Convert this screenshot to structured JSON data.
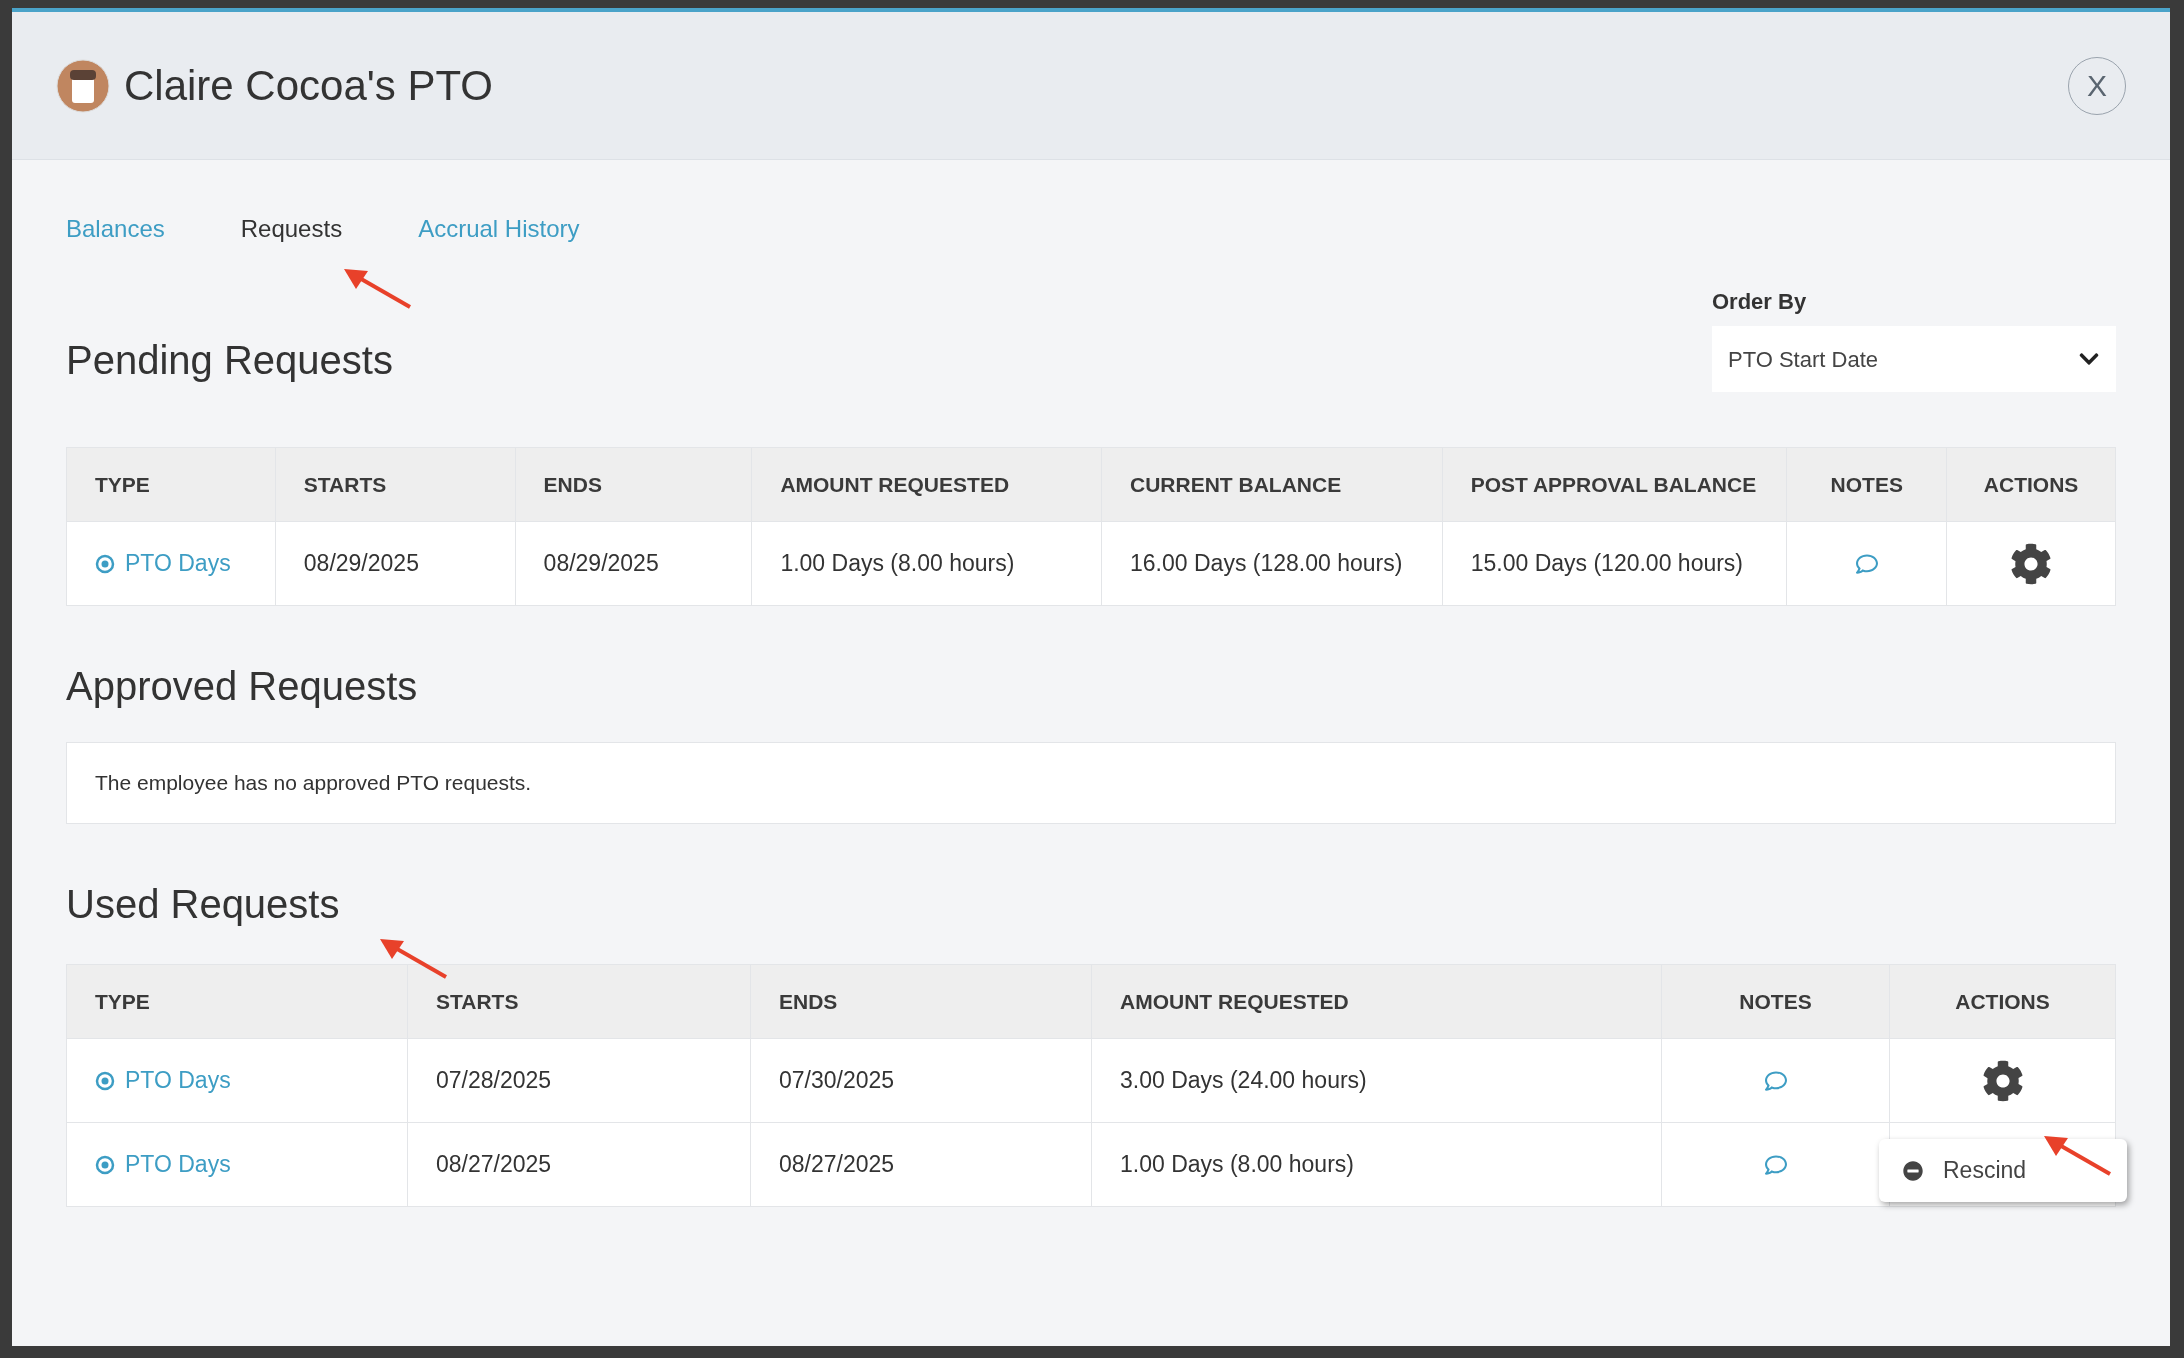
{
  "dialog": {
    "title": "Claire Cocoa's PTO",
    "close_label": "X"
  },
  "tabs": [
    {
      "label": "Balances",
      "selected": false
    },
    {
      "label": "Requests",
      "selected": true
    },
    {
      "label": "Accrual History",
      "selected": false
    }
  ],
  "order_by": {
    "label": "Order By",
    "value": "PTO Start Date"
  },
  "pending": {
    "heading": "Pending Requests",
    "columns": [
      "TYPE",
      "STARTS",
      "ENDS",
      "AMOUNT REQUESTED",
      "CURRENT BALANCE",
      "POST APPROVAL BALANCE",
      "NOTES",
      "ACTIONS"
    ],
    "rows": [
      {
        "cells": [
          "PTO Days",
          "08/29/2025",
          "08/29/2025",
          "1.00 Days (8.00 hours)",
          "16.00 Days (128.00 hours)",
          "15.00 Days (120.00 hours)"
        ]
      }
    ]
  },
  "approved": {
    "heading": "Approved Requests",
    "empty_message": "The employee has no approved PTO requests."
  },
  "used": {
    "heading": "Used Requests",
    "columns": [
      "TYPE",
      "STARTS",
      "ENDS",
      "AMOUNT REQUESTED",
      "NOTES",
      "ACTIONS"
    ],
    "rows": [
      {
        "cells": [
          "PTO Days",
          "07/28/2025",
          "07/30/2025",
          "3.00 Days (24.00 hours)"
        ],
        "menu": [
          {
            "label": "Rescind"
          }
        ]
      },
      {
        "cells": [
          "PTO Days",
          "08/27/2025",
          "08/27/2025",
          "1.00 Days (8.00 hours)"
        ]
      }
    ]
  }
}
